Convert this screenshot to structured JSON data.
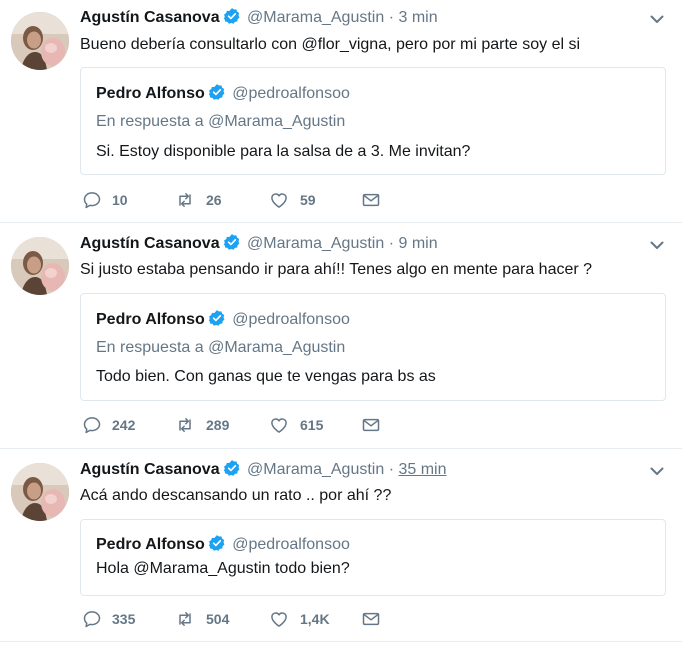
{
  "tweets": [
    {
      "name": "Agustín Casanova",
      "handle": "@Marama_Agustin",
      "dot": "·",
      "time": "3 min",
      "text": "Bueno debería consultarlo con @flor_vigna, pero por mi parte soy el si",
      "quote": {
        "name": "Pedro Alfonso",
        "handle": "@pedroalfonsoo",
        "reply": "En respuesta a @Marama_Agustin",
        "text": "Si. Estoy disponible para la salsa de a 3. Me invitan?"
      },
      "replies": "10",
      "retweets": "26",
      "likes": "59"
    },
    {
      "name": "Agustín Casanova",
      "handle": "@Marama_Agustin",
      "dot": "·",
      "time": "9 min",
      "text": "Si justo estaba pensando ir para ahí!! Tenes algo en mente para hacer ?",
      "quote": {
        "name": "Pedro Alfonso",
        "handle": "@pedroalfonsoo",
        "reply": "En respuesta a @Marama_Agustin",
        "text": "Todo bien. Con ganas que te vengas para bs as"
      },
      "replies": "242",
      "retweets": "289",
      "likes": "615"
    },
    {
      "name": "Agustín Casanova",
      "handle": "@Marama_Agustin",
      "dot": "·",
      "time": "35 min",
      "text": "Acá ando descansando un rato .. por ahí ??",
      "quote": {
        "name": "Pedro Alfonso",
        "handle": "@pedroalfonsoo",
        "text": "Hola @Marama_Agustin todo bien?"
      },
      "replies": "335",
      "retweets": "504",
      "likes": "1,4K"
    }
  ],
  "colors": {
    "verified": "#1da1f2",
    "muted": "#657786",
    "border": "#e1e8ed"
  },
  "icons": [
    "verified-badge-icon",
    "chevron-down-icon",
    "reply-icon",
    "retweet-icon",
    "like-icon",
    "direct-message-icon"
  ]
}
